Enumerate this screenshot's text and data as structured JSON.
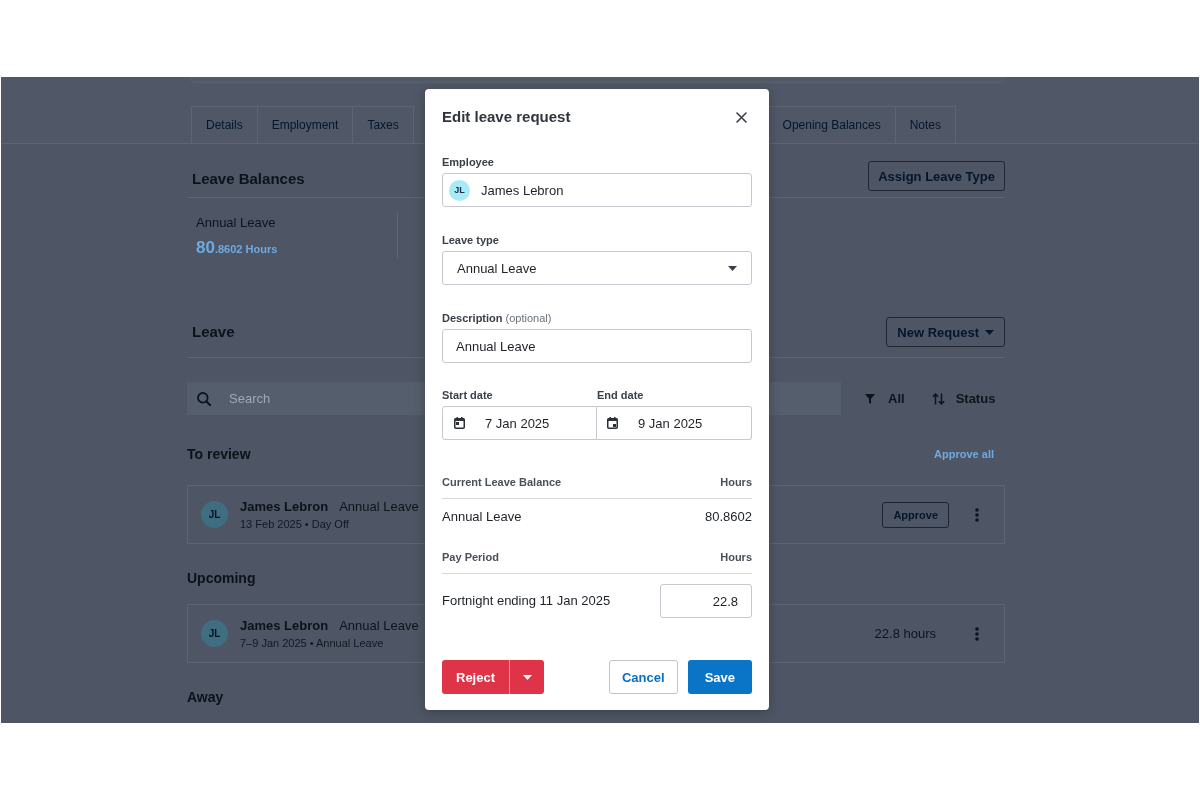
{
  "background_page": {
    "tabs_left": [
      {
        "label": "Details",
        "selected": false
      },
      {
        "label": "Employment",
        "selected": false
      },
      {
        "label": "Taxes",
        "selected": false
      }
    ],
    "tabs_right": [
      {
        "label": "Opening Balances",
        "selected": false
      },
      {
        "label": "Notes",
        "selected": false
      }
    ],
    "leave_balances": {
      "title": "Leave Balances",
      "assign_button": "Assign Leave Type",
      "balances": [
        {
          "name": "Annual Leave",
          "amount_whole": "80",
          "amount_fraction": ".8602 Hours"
        }
      ]
    },
    "leave": {
      "title": "Leave",
      "new_request_button": "New Request",
      "search": {
        "placeholder": "Search"
      },
      "filter": "All",
      "sort": "Status",
      "sections": [
        {
          "title": "To review",
          "action": "Approve all",
          "items": [
            {
              "kind": "pending",
              "initials": "JL",
              "name": "James Lebron",
              "leave_type": "Annual Leave",
              "detail": "13 Feb 2025 • Day Off",
              "button": "Approve"
            }
          ]
        },
        {
          "title": "Upcoming",
          "items": [
            {
              "kind": "scheduled",
              "initials": "JL",
              "name": "James Lebron",
              "leave_type": "Annual Leave",
              "detail": "7–9 Jan 2025 • Annual Leave",
              "hours": "22.8 hours"
            }
          ]
        },
        {
          "title": "Away"
        }
      ]
    }
  },
  "dialog": {
    "title": "Edit leave request",
    "employee": {
      "label": "Employee",
      "initials": "JL",
      "value": "James Lebron"
    },
    "leave_type": {
      "label": "Leave type",
      "value": "Annual Leave"
    },
    "description": {
      "label": "**Description** (optional)",
      "value": "Annual Leave"
    },
    "start_date": {
      "label": "Start date",
      "value": "7 Jan 2025"
    },
    "end_date": {
      "label": "End date",
      "value": "9 Jan 2025"
    },
    "balance_table": {
      "columns": [
        "Current Leave Balance",
        "Hours"
      ],
      "rows": [
        {
          "leave_type": "Annual Leave",
          "hours": "80.8602"
        }
      ]
    },
    "pay_period_table": {
      "columns": [
        "Pay Period",
        "Hours"
      ],
      "rows": [
        {
          "period": "Fortnight ending 11 Jan 2025",
          "hours": "22.8"
        }
      ]
    },
    "buttons": [
      {
        "label": "Reject",
        "kind": "split-danger"
      },
      {
        "label": "Cancel",
        "kind": "secondary"
      },
      {
        "label": "Save",
        "kind": "primary"
      }
    ]
  }
}
